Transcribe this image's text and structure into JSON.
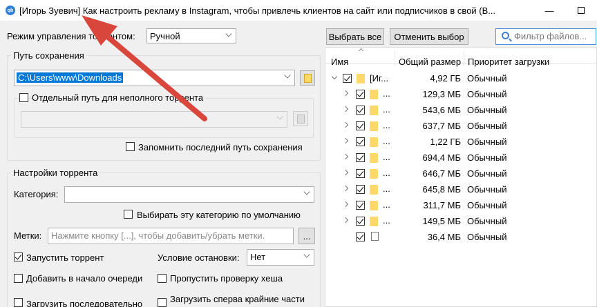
{
  "window": {
    "title": "[Игорь Зуевич] Как настроить рекламу в Instagram, чтобы привлечь клиентов на сайт или подписчиков в свой (В...",
    "app_icon_text": "qb"
  },
  "torrent_mode": {
    "label": "Режим управления торрентом:",
    "value": "Ручной"
  },
  "save_path": {
    "group_title": "Путь сохранения",
    "path_value": "C:\\Users\\www\\Downloads",
    "incomplete_label": "Отдельный путь для неполного торрента",
    "remember_label": "Запомнить последний путь сохранения"
  },
  "torrent_settings": {
    "group_title": "Настройки торрента",
    "category_label": "Категория:",
    "default_category_label": "Выбирать эту категорию по умолчанию",
    "tags_label": "Метки:",
    "tags_placeholder": "Нажмите кнопку [...], чтобы добавить/убрать метки.",
    "tags_button": "...",
    "start_label": "Запустить торрент",
    "start_checked": true,
    "stop_condition_label": "Условие остановки:",
    "stop_condition_value": "Нет",
    "add_top_label": "Добавить в начало очереди",
    "skip_hash_label": "Пропустить проверку хеша",
    "sequential_label": "Загрузить последовательно",
    "first_last_label": "Загрузить сперва крайние части"
  },
  "file_toolbar": {
    "select_all": "Выбрать все",
    "deselect": "Отменить выбор",
    "filter_placeholder": "Фильтр файлов..."
  },
  "file_tree": {
    "columns": [
      "Имя",
      "Общий размер",
      "Приоритет загрузки"
    ],
    "root": {
      "name": "[Иг...",
      "size": "4,92 ГБ",
      "priority": "Обычный"
    },
    "rows": [
      {
        "name": "...",
        "size": "129,3 МБ",
        "priority": "Обычный",
        "type": "folder"
      },
      {
        "name": "...",
        "size": "543,6 МБ",
        "priority": "Обычный",
        "type": "folder"
      },
      {
        "name": "...",
        "size": "637,7 МБ",
        "priority": "Обычный",
        "type": "folder"
      },
      {
        "name": "...",
        "size": "1,22 ГБ",
        "priority": "Обычный",
        "type": "folder"
      },
      {
        "name": "...",
        "size": "694,4 МБ",
        "priority": "Обычный",
        "type": "folder"
      },
      {
        "name": "...",
        "size": "646,7 МБ",
        "priority": "Обычный",
        "type": "folder"
      },
      {
        "name": "...",
        "size": "645,8 МБ",
        "priority": "Обычный",
        "type": "folder"
      },
      {
        "name": "...",
        "size": "311,7 МБ",
        "priority": "Обычный",
        "type": "folder"
      },
      {
        "name": "...",
        "size": "149,5 МБ",
        "priority": "Обычный",
        "type": "folder"
      },
      {
        "name": "",
        "size": "36,4 МБ",
        "priority": "Обычный",
        "type": "file"
      }
    ]
  },
  "colors": {
    "arrow": "#d9463b",
    "accent": "#4a90e2",
    "folder": "#ffd86b"
  }
}
